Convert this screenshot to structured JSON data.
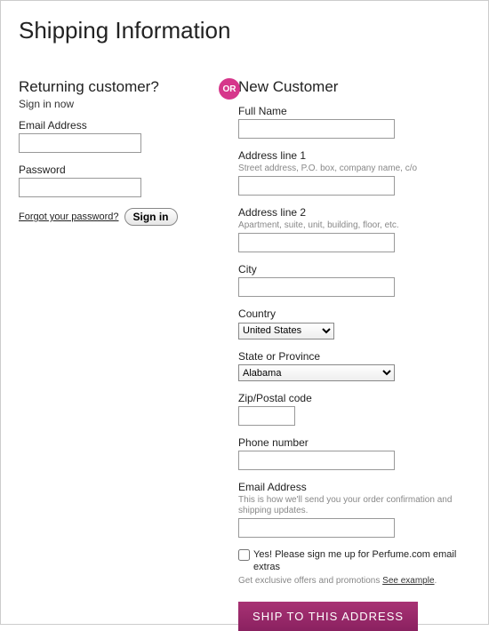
{
  "page_title": "Shipping Information",
  "or_label": "OR",
  "returning": {
    "heading": "Returning customer?",
    "sub": "Sign in now",
    "email_label": "Email Address",
    "password_label": "Password",
    "forgot_label": "Forgot your password?",
    "signin_label": "Sign in"
  },
  "new_customer": {
    "heading": "New Customer",
    "full_name_label": "Full Name",
    "addr1_label": "Address line 1",
    "addr1_hint": "Street address, P.O. box, company name, c/o",
    "addr2_label": "Address line 2",
    "addr2_hint": "Apartment, suite, unit, building, floor, etc.",
    "city_label": "City",
    "country_label": "Country",
    "country_value": "United States",
    "state_label": "State or Province",
    "state_value": "Alabama",
    "zip_label": "Zip/Postal code",
    "phone_label": "Phone number",
    "email_label": "Email Address",
    "email_hint": "This is how we'll send you your order confirmation and shipping updates.",
    "optin_label": "Yes! Please sign me up for Perfume.com email extras",
    "optin_hint": "Get exclusive offers and promotions ",
    "see_example": "See example",
    "ship_btn": "SHIP TO THIS ADDRESS"
  }
}
